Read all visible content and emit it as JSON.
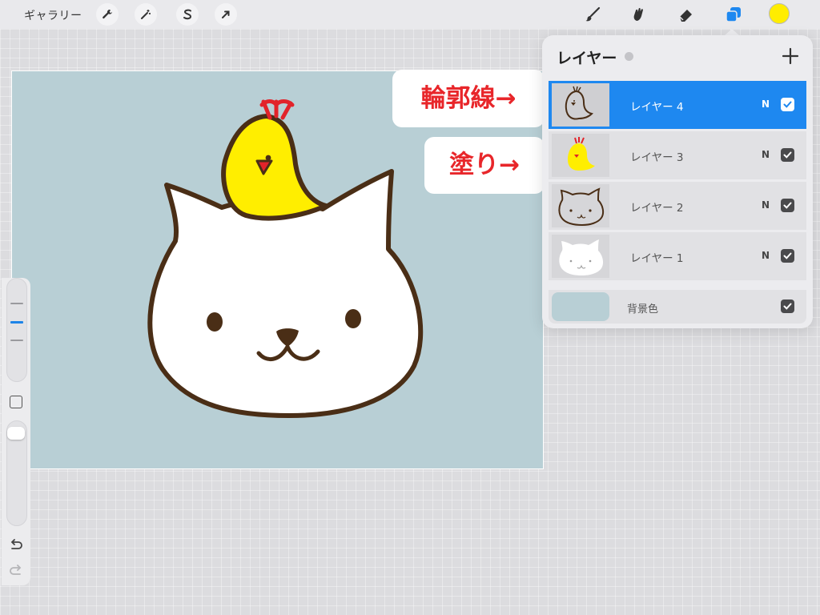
{
  "toolbar": {
    "gallery_label": "ギャラリー",
    "left_icons": [
      "wrench-icon",
      "magic-wand-icon",
      "selection-s-icon",
      "transform-arrow-icon"
    ],
    "right_icons": [
      "brush-icon",
      "smudge-icon",
      "eraser-icon",
      "layers-icon"
    ],
    "color_well": "#ffed00"
  },
  "annotations": {
    "outline": "輪郭線→",
    "fill": "塗り→",
    "text_color": "#e8262a"
  },
  "canvas": {
    "background": "#b8cfd5",
    "outline_color": "#4a2e16",
    "chick_color": "#ffee00",
    "cat_fill": "#ffffff",
    "comb_color": "#e2232a"
  },
  "layers_panel": {
    "title": "レイヤー",
    "add_icon": "plus-icon",
    "selected_color": "#1e88f0",
    "layers": [
      {
        "name": "レイヤー 4",
        "blend": "N",
        "visible": true,
        "selected": true
      },
      {
        "name": "レイヤー 3",
        "blend": "N",
        "visible": true,
        "selected": false
      },
      {
        "name": "レイヤー 2",
        "blend": "N",
        "visible": true,
        "selected": false
      },
      {
        "name": "レイヤー 1",
        "blend": "N",
        "visible": true,
        "selected": false
      }
    ],
    "background": {
      "name": "背景色",
      "visible": true
    }
  },
  "sidebar": {
    "size_slider_level": 0.5,
    "icons": [
      "modify-square-icon",
      "undo-icon",
      "redo-icon"
    ]
  }
}
